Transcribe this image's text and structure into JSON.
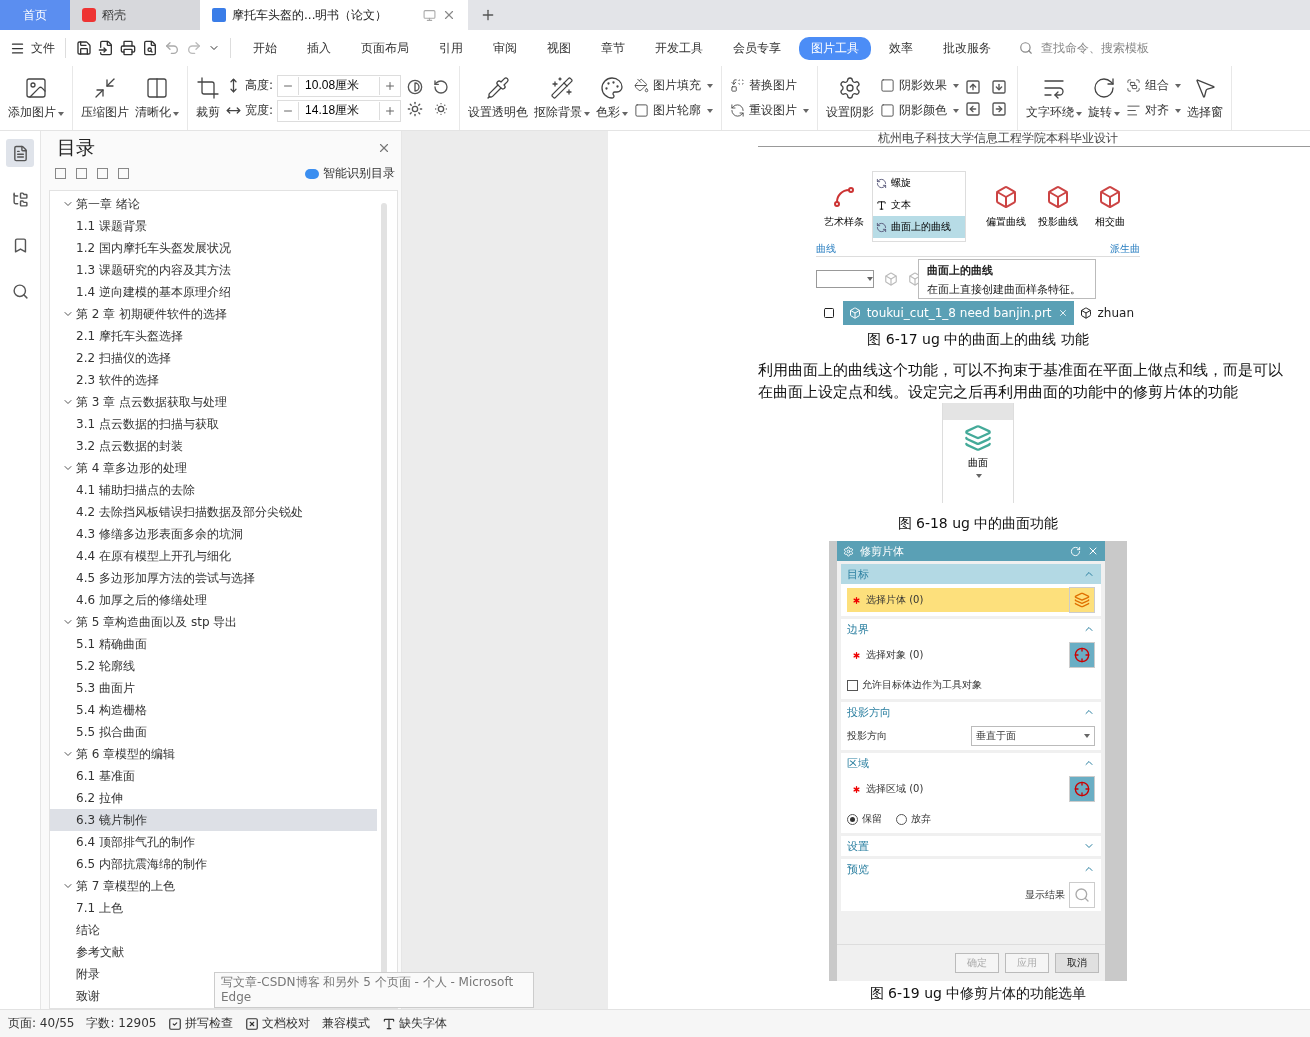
{
  "tabs": [
    {
      "label": "首页",
      "kind": "home",
      "selected": false
    },
    {
      "label": "稻壳",
      "kind": "app",
      "selected": false
    },
    {
      "label": "摩托车头盔的...明书（论文）",
      "kind": "doc",
      "selected": true
    }
  ],
  "menu": {
    "file": "文件",
    "items": [
      {
        "label": "开始",
        "selected": false
      },
      {
        "label": "插入",
        "selected": false
      },
      {
        "label": "页面布局",
        "selected": false
      },
      {
        "label": "引用",
        "selected": false
      },
      {
        "label": "审阅",
        "selected": false
      },
      {
        "label": "视图",
        "selected": false
      },
      {
        "label": "章节",
        "selected": false
      },
      {
        "label": "开发工具",
        "selected": false
      },
      {
        "label": "会员专享",
        "selected": false
      },
      {
        "label": "图片工具",
        "selected": true
      },
      {
        "label": "效率",
        "selected": false
      },
      {
        "label": "批改服务",
        "selected": false
      }
    ],
    "search": {
      "placeholder": "查找命令、搜索模板"
    }
  },
  "ribbon": [
    [
      {
        "kind": "large",
        "label": "添加图片",
        "dropdown": true
      }
    ],
    [
      {
        "kind": "large",
        "label": "压缩图片",
        "dropdown": false
      },
      {
        "kind": "large",
        "label": "清晰化",
        "dropdown": true
      }
    ],
    [
      {
        "kind": "large",
        "label": "裁剪",
        "dropdown": false
      },
      {
        "kind": "spins",
        "items": [
          {
            "label": "高度:",
            "value": "10.08厘米"
          },
          {
            "label": "宽度:",
            "value": "14.18厘米"
          }
        ]
      },
      {
        "kind": "adjust"
      }
    ],
    [
      {
        "kind": "large",
        "label": "设置透明色",
        "dropdown": false
      },
      {
        "kind": "large",
        "label": "抠除背景",
        "dropdown": true
      },
      {
        "kind": "large",
        "label": "色彩",
        "dropdown": true
      },
      {
        "kind": "smalls",
        "items": [
          {
            "label": "图片填充",
            "dropdown": true
          },
          {
            "label": "图片轮廓",
            "dropdown": true
          }
        ]
      }
    ],
    [
      {
        "kind": "smalls",
        "items": [
          {
            "label": "替换图片",
            "dropdown": false
          },
          {
            "label": "重设图片",
            "dropdown": true
          }
        ]
      }
    ],
    [
      {
        "kind": "large",
        "label": "设置阴影",
        "dropdown": false
      },
      {
        "kind": "smalls",
        "items": [
          {
            "label": "阴影效果",
            "dropdown": true
          },
          {
            "label": "阴影颜色",
            "dropdown": true
          }
        ]
      },
      {
        "kind": "nudge"
      }
    ],
    [
      {
        "kind": "large",
        "label": "文字环绕",
        "dropdown": true
      },
      {
        "kind": "large",
        "label": "旋转",
        "dropdown": true
      },
      {
        "kind": "smalls",
        "items": [
          {
            "label": "组合",
            "dropdown": true
          },
          {
            "label": "对齐",
            "dropdown": true
          }
        ]
      },
      {
        "kind": "large",
        "label": "选择窗",
        "dropdown": false
      }
    ]
  ],
  "toc": {
    "title": "目录",
    "smart": "智能识别目录",
    "items": [
      {
        "label": "第一章  绪论",
        "expanded": true,
        "selected": false,
        "children": [
          {
            "label": "1.1 课题背景",
            "selected": false
          },
          {
            "label": "1.2 国内摩托车头盔发展状况",
            "selected": false
          },
          {
            "label": "1.3 课题研究的内容及其方法",
            "selected": false
          },
          {
            "label": "1.4 逆向建模的基本原理介绍",
            "selected": false
          }
        ]
      },
      {
        "label": "第 2 章  初期硬件软件的选择",
        "expanded": true,
        "selected": false,
        "children": [
          {
            "label": "2.1 摩托车头盔选择",
            "selected": false
          },
          {
            "label": "2.2 扫描仪的选择",
            "selected": false
          },
          {
            "label": "2.3  软件的选择",
            "selected": false
          }
        ]
      },
      {
        "label": "第 3 章    点云数据获取与处理",
        "expanded": true,
        "selected": false,
        "children": [
          {
            "label": "3.1  点云数据的扫描与获取",
            "selected": false
          },
          {
            "label": "3.2  点云数据的封装",
            "selected": false
          }
        ]
      },
      {
        "label": "第 4 章多边形的处理",
        "expanded": true,
        "selected": false,
        "children": [
          {
            "label": "4.1  辅助扫描点的去除",
            "selected": false
          },
          {
            "label": "4.2  去除挡风板错误扫描数据及部分尖锐处",
            "selected": false
          },
          {
            "label": "4.3  修缮多边形表面多余的坑洞",
            "selected": false
          },
          {
            "label": "4.4  在原有模型上开孔与细化",
            "selected": false
          },
          {
            "label": "4.5  多边形加厚方法的尝试与选择",
            "selected": false
          },
          {
            "label": "4.6  加厚之后的修缮处理",
            "selected": false
          }
        ]
      },
      {
        "label": "第 5 章构造曲面以及 stp 导出",
        "expanded": true,
        "selected": false,
        "children": [
          {
            "label": "5.1  精确曲面",
            "selected": false
          },
          {
            "label": "5.2  轮廓线",
            "selected": false
          },
          {
            "label": "5.3  曲面片",
            "selected": false
          },
          {
            "label": "5.4  构造栅格",
            "selected": false
          },
          {
            "label": "5.5  拟合曲面",
            "selected": false
          }
        ]
      },
      {
        "label": "第 6 章模型的编辑",
        "expanded": true,
        "selected": false,
        "children": [
          {
            "label": "6.1  基准面",
            "selected": false
          },
          {
            "label": "6.2  拉伸",
            "selected": false
          },
          {
            "label": "6.3  镜片制作",
            "selected": true
          },
          {
            "label": "6.4  顶部排气孔的制作",
            "selected": false
          },
          {
            "label": "6.5  内部抗震海绵的制作",
            "selected": false
          }
        ]
      },
      {
        "label": "第 7 章模型的上色",
        "expanded": true,
        "selected": false,
        "children": [
          {
            "label": "7.1  上色",
            "selected": false
          }
        ]
      },
      {
        "label": "结论",
        "selected": false
      },
      {
        "label": "参考文献",
        "selected": false
      },
      {
        "label": "附录",
        "selected": false
      },
      {
        "label": "致谢",
        "selected": false
      }
    ]
  },
  "document": {
    "header": "杭州电子科技大学信息工程学院本科毕业设计",
    "fig17": {
      "art_tool": "艺术样条",
      "list": [
        {
          "label": "螺旋",
          "selected": false
        },
        {
          "label": "文本",
          "selected": false
        },
        {
          "label": "曲面上的曲线",
          "selected": true
        }
      ],
      "tools": [
        "偏置曲线",
        "投影曲线",
        "相交曲"
      ],
      "group_left": "曲线",
      "group_right": "派生曲",
      "tooltip": {
        "title": "曲面上的曲线",
        "text": "在面上直接创建曲面样条特征。"
      },
      "tabs": [
        {
          "label": "toukui_cut_1_8 need banjin.prt",
          "selected": true
        },
        {
          "label": "zhuan",
          "selected": false
        }
      ],
      "caption": "图 6-17  ug 中的曲面上的曲线 功能"
    },
    "paragraph": [
      "利用曲面上的曲线这个功能，可以不拘束于基准面在平面上做点和线，而是可以",
      "在曲面上设定点和线。设定完之后再利用曲面的功能中的修剪片体的功能"
    ],
    "fig18": {
      "label": "曲面",
      "caption": "图 6-18  ug 中的曲面功能"
    },
    "fig19": {
      "title": "修剪片体",
      "sections": [
        {
          "title": "目标",
          "expanded": true,
          "highlighted": true,
          "rows": [
            {
              "kind": "select",
              "label": "选择片体 (0)",
              "active": true
            }
          ]
        },
        {
          "title": "边界",
          "expanded": true,
          "highlighted": false,
          "rows": [
            {
              "kind": "select",
              "label": "选择对象 (0)",
              "active": false
            },
            {
              "kind": "checkbox",
              "label": "允许目标体边作为工具对象",
              "checked": false
            }
          ]
        },
        {
          "title": "投影方向",
          "expanded": true,
          "highlighted": false,
          "rows": [
            {
              "kind": "dropdown",
              "label": "投影方向",
              "value": "垂直于面"
            }
          ]
        },
        {
          "title": "区域",
          "expanded": true,
          "highlighted": false,
          "rows": [
            {
              "kind": "select",
              "label": "选择区域 (0)",
              "active": false
            },
            {
              "kind": "radio",
              "options": [
                {
                  "label": "保留",
                  "selected": true
                },
                {
                  "label": "放弃",
                  "selected": false
                }
              ]
            }
          ]
        },
        {
          "title": "设置",
          "expanded": false,
          "highlighted": false
        },
        {
          "title": "预览",
          "expanded": true,
          "highlighted": false,
          "rows": [
            {
              "kind": "result",
              "label": "显示结果"
            }
          ]
        }
      ],
      "buttons": [
        {
          "label": "确定",
          "disabled": true
        },
        {
          "label": "应用",
          "disabled": true
        },
        {
          "label": "取消",
          "disabled": false
        }
      ],
      "caption": "图 6-19  ug 中修剪片体的功能选单"
    }
  },
  "status": [
    {
      "kind": "text",
      "label": "页面: 40/55"
    },
    {
      "kind": "text",
      "label": "字数: 12905"
    },
    {
      "kind": "check",
      "label": "拼写检查",
      "checked": true
    },
    {
      "kind": "proof",
      "label": "文档校对"
    },
    {
      "kind": "text",
      "label": "兼容模式"
    },
    {
      "kind": "font",
      "label": "缺失字体"
    }
  ],
  "taskbar_tooltip": "写文章-CSDN博客 和另外 5 个页面 - 个人 - Microsoft Edge"
}
